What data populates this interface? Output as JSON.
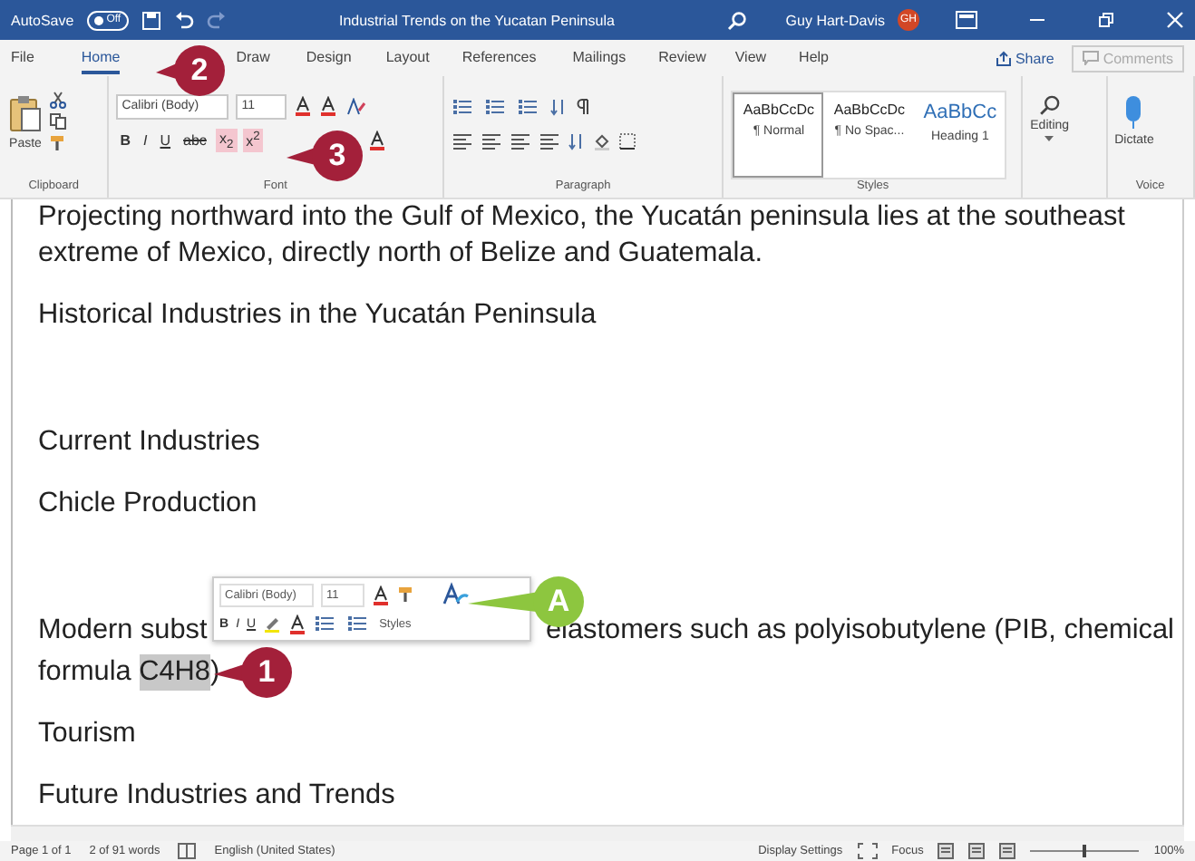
{
  "title_bar": {
    "autosave_label": "AutoSave",
    "autosave": {
      "label": "Off",
      "on": false
    },
    "document_title": "Industrial Trends on the Yucatan Peninsula",
    "user_name": "Guy Hart-Davis",
    "user_initials": "GH"
  },
  "tabs": [
    {
      "label": "File",
      "selected": false
    },
    {
      "label": "Home",
      "selected": true
    },
    {
      "label": "Draw",
      "selected": false
    },
    {
      "label": "Design",
      "selected": false
    },
    {
      "label": "Layout",
      "selected": false
    },
    {
      "label": "References",
      "selected": false
    },
    {
      "label": "Mailings",
      "selected": false
    },
    {
      "label": "Review",
      "selected": false
    },
    {
      "label": "View",
      "selected": false
    },
    {
      "label": "Help",
      "selected": false
    }
  ],
  "share_button": "Share",
  "comments_button": {
    "label": "Comments",
    "disabled": true
  },
  "ribbon": {
    "clipboard": {
      "paste": "Paste",
      "label": "Clipboard"
    },
    "font": {
      "font_name": "Calibri (Body)",
      "font_size": "11",
      "label": "Font",
      "format_buttons": [
        {
          "text": "B",
          "kind": "bold",
          "active": false
        },
        {
          "text": "I",
          "kind": "italic",
          "active": false
        },
        {
          "text": "U",
          "kind": "underline",
          "active": false
        },
        {
          "text": "abc",
          "kind": "strike",
          "active": false
        },
        {
          "text": "x$_{2}$",
          "kind": "plain",
          "active": true
        },
        {
          "text": "x$^{2}$",
          "kind": "plain",
          "active": true
        }
      ]
    },
    "paragraph": {
      "label": "Paragraph"
    },
    "styles": {
      "label": "Styles",
      "items": [
        {
          "preview": "AaBbCcDc",
          "name": "¶ Normal",
          "kind": "normal",
          "selected": true
        },
        {
          "preview": "AaBbCcDc",
          "name": "¶ No Spac...",
          "kind": "normal",
          "selected": false
        },
        {
          "preview": "AaBbCc",
          "name": "Heading 1",
          "kind": "heading",
          "selected": false
        }
      ]
    },
    "editing": {
      "label": "Editing"
    },
    "voice": {
      "button": "Dictate",
      "label": "Voice"
    }
  },
  "document": {
    "paragraphs": [
      {
        "lines": [
          {
            "kind": "text",
            "text": "Projecting northward into the Gulf of Mexico, the Yucatán peninsula lies at the southeast"
          },
          {
            "kind": "text",
            "text": "extreme of Mexico, directly north of Belize and Guatemala."
          }
        ]
      },
      {
        "lines": [
          {
            "kind": "text",
            "text": "Historical Industries in the Yucatán Peninsula"
          }
        ]
      },
      {
        "lines": [
          {
            "kind": "text",
            "text": "Current Industries"
          }
        ]
      },
      {
        "lines": [
          {
            "kind": "text",
            "text": "Chicle Production"
          }
        ]
      },
      {
        "lines": [
          {
            "kind": "split",
            "parts": [
              "Modern subst",
              "elastomers such as polyisobutylene (PIB, chemical"
            ]
          },
          {
            "kind": "runs",
            "runs": [
              {
                "text": "formula ",
                "selected": false
              },
              {
                "text": "C4H8",
                "selected": true
              },
              {
                "text": ")",
                "selected": false
              }
            ]
          }
        ]
      },
      {
        "lines": [
          {
            "kind": "text",
            "text": "Tourism"
          }
        ]
      },
      {
        "lines": [
          {
            "kind": "text",
            "text": "Future Industries and Trends"
          }
        ]
      }
    ]
  },
  "mini_toolbar": {
    "font_name": "Calibri (Body)",
    "font_size": "11",
    "format_buttons": [
      "B",
      "I",
      "U"
    ],
    "styles_label": "Styles"
  },
  "callouts": [
    {
      "label": "2",
      "color": "#a3203a"
    },
    {
      "label": "3",
      "color": "#a3203a"
    },
    {
      "label": "1",
      "color": "#a3203a"
    },
    {
      "label": "A",
      "color": "#8dc63f"
    }
  ],
  "status_bar": {
    "page": "Page 1 of 1",
    "words": "2 of 91 words",
    "language": "English (United States)",
    "display_settings": "Display Settings",
    "focus": "Focus",
    "zoom_slider": {
      "level": 0.5
    },
    "zoom": "100%"
  }
}
